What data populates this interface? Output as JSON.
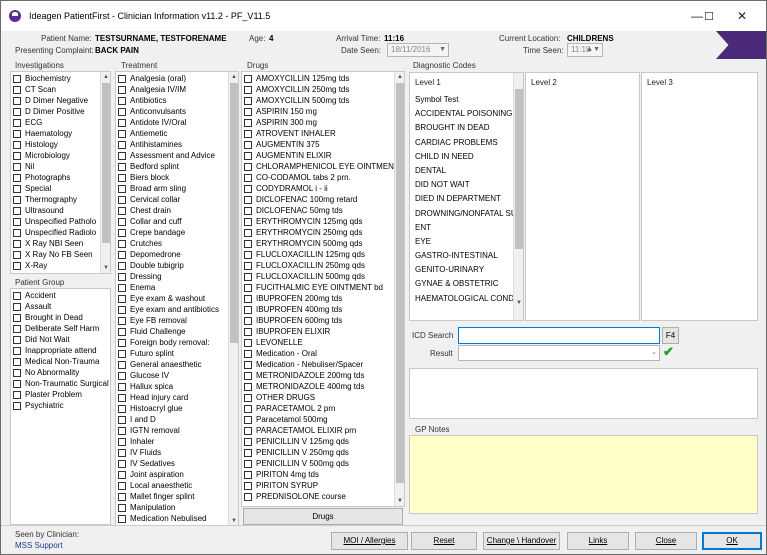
{
  "window": {
    "title": "Ideagen PatientFirst - Clinician Information v11.2 - PF_V11.5",
    "minimize_glyph": "—",
    "maximize_glyph": "☐",
    "close_glyph": "✕"
  },
  "header": {
    "patient_name_label": "Patient Name:",
    "patient_name": "TESTSURNAME, TESTFORENAME",
    "age_label": "Age:",
    "age": "4",
    "arrival_time_label": "Arrival Time:",
    "arrival_time": "11:16",
    "current_location_label": "Current Location:",
    "current_location": "CHILDRENS",
    "presenting_complaint_label": "Presenting Complaint:",
    "presenting_complaint": "BACK PAIN",
    "date_seen_label": "Date Seen:",
    "date_seen": "18/11/2016",
    "time_seen_label": "Time Seen:",
    "time_seen": "11:18",
    "accent_color": "#4b2a7b"
  },
  "investigations": {
    "title": "Investigations",
    "items": [
      "Biochemistry",
      "CT Scan",
      "D Dimer Negative",
      "D Dimer Positive",
      "ECG",
      "Haematology",
      "Histology",
      "Microbiology",
      "Nil",
      "Photographs",
      "Special",
      "Thermography",
      "Ultrasound",
      "Unspecified Patholo",
      "Unspecified Radiolo",
      "X Ray NBI Seen",
      "X Ray No FB Seen",
      "X-Ray"
    ]
  },
  "patient_group": {
    "title": "Patient Group",
    "items": [
      "Accident",
      "Assault",
      "Brought in Dead",
      "Deliberate Self Harm",
      "Did Not Wait",
      "Inappropriate attend",
      "Medical Non-Trauma",
      "No Abnormality",
      "Non-Traumatic Surgical",
      "Plaster Problem",
      "Psychiatric"
    ]
  },
  "treatment": {
    "title": "Treatment",
    "items": [
      "Analgesia (oral)",
      "Analgesia IV/IM",
      "Antibiotics",
      "Anticonvulsants",
      "Antidote IV/Oral",
      "Antiemetic",
      "Antihistamines",
      "Assessment and Advice",
      "Bedford splint",
      "Biers block",
      "Broad arm sling",
      "Cervical collar",
      "Chest drain",
      "Collar and cuff",
      "Crepe bandage",
      "Crutches",
      "Depomedrone",
      "Double tubigrip",
      "Dressing",
      "Enema",
      "Eye exam & washout",
      "Eye exam and antibiotics",
      "Eye FB removal",
      "Fluid Challenge",
      "Foreign body removal:",
      "Futuro splint",
      "General anaesthetic",
      "Glucose IV",
      "Hallux spica",
      "Head injury card",
      "Histoacryl glue",
      "I and  D",
      "IGTN removal",
      "Inhaler",
      "IV Fluids",
      "IV Sedatives",
      "Joint aspiration",
      "Local anaesthetic",
      "Mallet finger splint",
      "Manipulation",
      "Medication Nebulised"
    ]
  },
  "drugs": {
    "title": "Drugs",
    "button_label": "Drugs",
    "items": [
      "AMOXYCILLIN 125mg tds",
      "AMOXYCILLIN 250mg tds",
      "AMOXYCILLIN 500mg tds",
      "ASPIRIN 150 mg",
      "ASPIRIN 300 mg",
      "ATROVENT INHALER",
      "AUGMENTIN 375",
      "AUGMENTIN ELIXIR",
      "CHLORAMPHENICOL EYE OINTMENT",
      "CO-CODAMOL tabs 2 prn.",
      "CODYDRAMOL i - ii",
      "DICLOFENAC 100mg retard",
      "DICLOFENAC 50mg tds",
      "ERYTHROMYCIN 125mg qds",
      "ERYTHROMYCIN 250mg qds",
      "ERYTHROMYCIN 500mg qds",
      "FLUCLOXACILLIN 125mg qds",
      "FLUCLOXACILLIN 250mg qds",
      "FLUCLOXACILLIN 500mg qds",
      "FUCITHALMIC EYE OINTMENT bd",
      "IBUPROFEN 200mg tds",
      "IBUPROFEN 400mg tds",
      "IBUPROFEN 600mg tds",
      "IBUPROFEN ELIXIR",
      "LEVONELLE",
      "Medication -  Oral",
      "Medication - Nebuliser/Spacer",
      "METRONIDAZOLE 200mg tds",
      "METRONIDAZOLE 400mg tds",
      "OTHER DRUGS",
      "PARACETAMOL 2  prn",
      "Paracetamol 500mg",
      "PARACETAMOL ELIXIR prn",
      "PENICILLIN V 125mg qds",
      "PENICILLIN V 250mg qds",
      "PENICILLIN V 500mg qds",
      "PIRITON 4mg tds",
      "PIRITON SYRUP",
      "PREDNISOLONE course"
    ]
  },
  "diagnostic": {
    "title": "Diagnostic Codes",
    "level1_label": "Level 1",
    "level2_label": "Level 2",
    "level3_label": "Level 3",
    "level1_items": [
      "Symbol Test",
      "ACCIDENTAL POISONING",
      "BROUGHT IN DEAD",
      "CARDIAC PROBLEMS",
      "CHILD IN NEED",
      "DENTAL",
      "DID NOT WAIT",
      "DIED IN DEPARTMENT",
      "DROWNING/NONFATAL SU",
      "ENT",
      "EYE",
      "GASTRO-INTESTINAL",
      "GENITO-URINARY",
      "GYNAE & OBSTETRIC",
      "HAEMATOLOGICAL CONDI"
    ]
  },
  "icd": {
    "search_label": "ICD Search",
    "search_value": "",
    "f4_label": "F4",
    "result_label": "Result",
    "result_value": ""
  },
  "gp_notes": {
    "title": "GP Notes",
    "value": "",
    "bg_color": "#ffffc8"
  },
  "footer": {
    "seen_by_label": "Seen by Clinician:",
    "seen_by_value": "MSS Support",
    "buttons": {
      "moi": "MOI / Allergies",
      "reset": "Reset",
      "change": "Change \\ Handover",
      "links": "Links",
      "close": "Close",
      "ok": "OK"
    }
  }
}
